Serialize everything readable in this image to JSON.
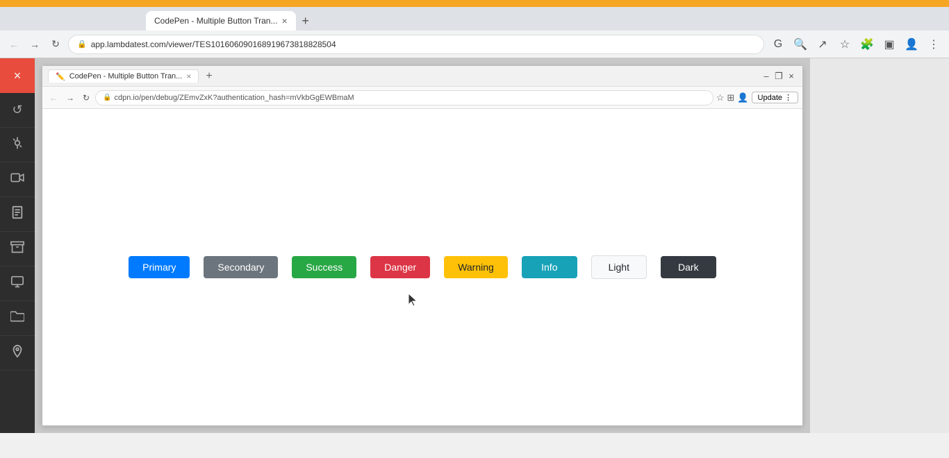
{
  "topbar": {
    "bg_color": "#f5a623"
  },
  "browser": {
    "tab_title": "CodePen - Multiple Button Tran...",
    "address": "app.lambdatest.com/viewer/TES101606090168919673818828504",
    "embedded_address": "cdpn.io/pen/debug/ZEmvZxK?authentication_hash=mVkbGgEWBmaM",
    "update_label": "Update"
  },
  "sidebar": {
    "close_icon": "×",
    "items": [
      {
        "name": "sidebar-item-back",
        "icon": "↺"
      },
      {
        "name": "sidebar-item-bug",
        "icon": "🐛"
      },
      {
        "name": "sidebar-item-video",
        "icon": "📹"
      },
      {
        "name": "sidebar-item-pages",
        "icon": "📄"
      },
      {
        "name": "sidebar-item-box",
        "icon": "📦"
      },
      {
        "name": "sidebar-item-monitor",
        "icon": "🖥"
      },
      {
        "name": "sidebar-item-folder",
        "icon": "📁"
      },
      {
        "name": "sidebar-item-location",
        "icon": "📍"
      }
    ]
  },
  "buttons": [
    {
      "id": "primary",
      "label": "Primary",
      "class": "btn-primary"
    },
    {
      "id": "secondary",
      "label": "Secondary",
      "class": "btn-secondary"
    },
    {
      "id": "success",
      "label": "Success",
      "class": "btn-success"
    },
    {
      "id": "danger",
      "label": "Danger",
      "class": "btn-danger"
    },
    {
      "id": "warning",
      "label": "Warning",
      "class": "btn-warning"
    },
    {
      "id": "info",
      "label": "Info",
      "class": "btn-info"
    },
    {
      "id": "light",
      "label": "Light",
      "class": "btn-light"
    },
    {
      "id": "dark",
      "label": "Dark",
      "class": "btn-dark"
    }
  ]
}
